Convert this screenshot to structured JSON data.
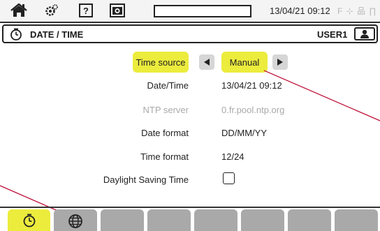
{
  "status_bar": {
    "date_time": "13/04/21 09:12",
    "right_indicator": "F ⊹ 品 ∏",
    "icons": [
      "home-icon",
      "settings-icon",
      "help-icon",
      "camera-icon",
      "battery-icon"
    ],
    "help_glyph": "?"
  },
  "title_bar": {
    "title": "DATE / TIME",
    "user": "USER1",
    "icons": [
      "clock-icon",
      "user-icon"
    ]
  },
  "form": {
    "time_source": {
      "label": "Time source",
      "value": "Manual"
    },
    "date_time": {
      "label": "Date/Time",
      "value": "13/04/21 09:12"
    },
    "ntp_server": {
      "label": "NTP server",
      "value": "0.fr.pool.ntp.org"
    },
    "date_format": {
      "label": "Date format",
      "value": "DD/MM/YY"
    },
    "time_format": {
      "label": "Time format",
      "value": "12/24"
    },
    "daylight_saving": {
      "label": "Daylight Saving Time",
      "checked": false
    }
  },
  "tabs": [
    {
      "icon": "clock-icon",
      "active": true
    },
    {
      "icon": "globe-icon",
      "active": false
    },
    {
      "icon": "",
      "active": false
    },
    {
      "icon": "",
      "active": false
    },
    {
      "icon": "",
      "active": false
    },
    {
      "icon": "",
      "active": false
    },
    {
      "icon": "",
      "active": false
    },
    {
      "icon": "",
      "active": false
    }
  ],
  "colors": {
    "highlight": "#ecec3d",
    "tab_inactive": "#a9a9a9",
    "callout_line": "#c0143c",
    "disabled_text": "#a9a9a9"
  }
}
